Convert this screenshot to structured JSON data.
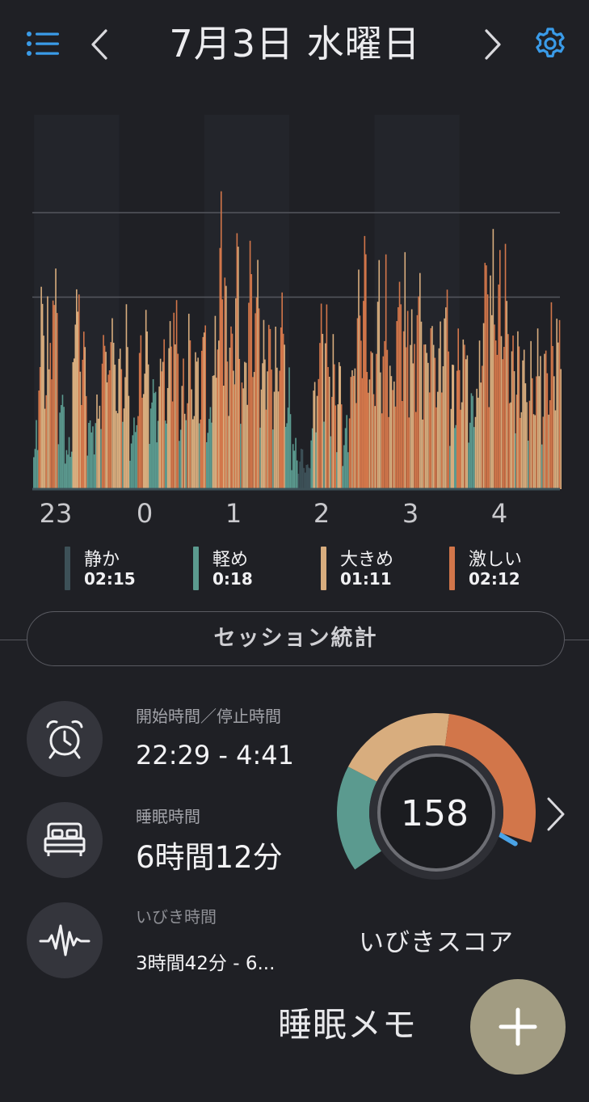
{
  "header": {
    "title": "7月3日 水曜日",
    "menu_icon": "list-icon",
    "prev_icon": "chevron-left-icon",
    "next_icon": "chevron-right-icon",
    "settings_icon": "gear-icon",
    "accent_color": "#3a9be8"
  },
  "chart_data": {
    "type": "bar",
    "x_ticks": [
      "23",
      "0",
      "1",
      "2",
      "3",
      "4"
    ],
    "x_range_hours": [
      22.48,
      4.68
    ],
    "y_range": [
      0,
      1
    ],
    "stacked_by_category": true,
    "grid": true,
    "bin_minutes": 0.9,
    "samples": [
      {
        "t": 22.49,
        "v": 0.24,
        "c": 3
      },
      {
        "t": 22.55,
        "v": 0.7,
        "c": 3
      },
      {
        "t": 22.62,
        "v": 0.58,
        "c": 2
      },
      {
        "t": 22.7,
        "v": 0.86,
        "c": 3
      },
      {
        "t": 22.78,
        "v": 0.42,
        "c": 1
      },
      {
        "t": 22.86,
        "v": 0.18,
        "c": 1
      },
      {
        "t": 22.95,
        "v": 0.75,
        "c": 2
      },
      {
        "t": 23.05,
        "v": 0.52,
        "c": 3
      },
      {
        "t": 23.12,
        "v": 0.3,
        "c": 1
      },
      {
        "t": 23.2,
        "v": 0.34,
        "c": 2
      },
      {
        "t": 23.28,
        "v": 0.62,
        "c": 3
      },
      {
        "t": 23.38,
        "v": 0.74,
        "c": 2
      },
      {
        "t": 23.46,
        "v": 0.5,
        "c": 3
      },
      {
        "t": 23.55,
        "v": 0.62,
        "c": 2
      },
      {
        "t": 23.62,
        "v": 0.28,
        "c": 1
      },
      {
        "t": 23.7,
        "v": 0.47,
        "c": 3
      },
      {
        "t": 23.78,
        "v": 0.58,
        "c": 2
      },
      {
        "t": 23.85,
        "v": 0.35,
        "c": 1
      },
      {
        "t": 23.95,
        "v": 0.52,
        "c": 3
      },
      {
        "t": 24.05,
        "v": 0.6,
        "c": 2
      },
      {
        "t": 24.12,
        "v": 0.72,
        "c": 3
      },
      {
        "t": 24.2,
        "v": 0.4,
        "c": 2
      },
      {
        "t": 24.28,
        "v": 0.55,
        "c": 3
      },
      {
        "t": 24.36,
        "v": 0.46,
        "c": 2
      },
      {
        "t": 24.45,
        "v": 0.66,
        "c": 3
      },
      {
        "t": 24.52,
        "v": 0.3,
        "c": 1
      },
      {
        "t": 24.58,
        "v": 0.55,
        "c": 2
      },
      {
        "t": 24.65,
        "v": 0.98,
        "c": 3
      },
      {
        "t": 24.72,
        "v": 0.8,
        "c": 3
      },
      {
        "t": 24.78,
        "v": 0.6,
        "c": 2
      },
      {
        "t": 24.85,
        "v": 0.92,
        "c": 3
      },
      {
        "t": 24.92,
        "v": 0.5,
        "c": 2
      },
      {
        "t": 25.0,
        "v": 0.78,
        "c": 3
      },
      {
        "t": 25.08,
        "v": 0.82,
        "c": 3
      },
      {
        "t": 25.15,
        "v": 0.64,
        "c": 2
      },
      {
        "t": 25.22,
        "v": 0.78,
        "c": 3
      },
      {
        "t": 25.3,
        "v": 0.5,
        "c": 2
      },
      {
        "t": 25.38,
        "v": 0.76,
        "c": 3
      },
      {
        "t": 25.45,
        "v": 0.4,
        "c": 1
      },
      {
        "t": 25.52,
        "v": 0.2,
        "c": 1
      },
      {
        "t": 25.6,
        "v": 0.12,
        "c": 0
      },
      {
        "t": 25.68,
        "v": 0.1,
        "c": 0
      },
      {
        "t": 25.75,
        "v": 0.4,
        "c": 3
      },
      {
        "t": 25.82,
        "v": 0.65,
        "c": 3
      },
      {
        "t": 25.9,
        "v": 0.64,
        "c": 2
      },
      {
        "t": 25.98,
        "v": 0.55,
        "c": 3
      },
      {
        "t": 26.05,
        "v": 0.38,
        "c": 2
      },
      {
        "t": 26.12,
        "v": 0.22,
        "c": 1
      },
      {
        "t": 26.2,
        "v": 0.48,
        "c": 3
      },
      {
        "t": 26.28,
        "v": 0.72,
        "c": 3
      },
      {
        "t": 26.35,
        "v": 0.8,
        "c": 3
      },
      {
        "t": 26.42,
        "v": 0.56,
        "c": 2
      },
      {
        "t": 26.5,
        "v": 0.78,
        "c": 3
      },
      {
        "t": 26.58,
        "v": 0.74,
        "c": 3
      },
      {
        "t": 26.66,
        "v": 0.5,
        "c": 2
      },
      {
        "t": 26.74,
        "v": 0.75,
        "c": 3
      },
      {
        "t": 26.82,
        "v": 0.7,
        "c": 3
      },
      {
        "t": 26.9,
        "v": 0.62,
        "c": 2
      },
      {
        "t": 26.98,
        "v": 0.74,
        "c": 3
      },
      {
        "t": 27.06,
        "v": 0.66,
        "c": 2
      },
      {
        "t": 27.14,
        "v": 0.7,
        "c": 3
      },
      {
        "t": 27.22,
        "v": 0.58,
        "c": 2
      },
      {
        "t": 27.3,
        "v": 0.72,
        "c": 3
      },
      {
        "t": 27.38,
        "v": 0.4,
        "c": 2
      },
      {
        "t": 27.45,
        "v": 0.55,
        "c": 3
      },
      {
        "t": 27.52,
        "v": 0.62,
        "c": 2
      },
      {
        "t": 27.6,
        "v": 0.3,
        "c": 1
      },
      {
        "t": 27.68,
        "v": 0.45,
        "c": 2
      },
      {
        "t": 27.76,
        "v": 0.86,
        "c": 3
      },
      {
        "t": 27.84,
        "v": 0.84,
        "c": 3
      },
      {
        "t": 27.92,
        "v": 0.88,
        "c": 3
      },
      {
        "t": 28.0,
        "v": 0.84,
        "c": 3
      },
      {
        "t": 28.08,
        "v": 0.6,
        "c": 2
      },
      {
        "t": 28.15,
        "v": 0.48,
        "c": 3
      },
      {
        "t": 28.22,
        "v": 0.52,
        "c": 2
      },
      {
        "t": 28.3,
        "v": 0.44,
        "c": 3
      },
      {
        "t": 28.38,
        "v": 0.56,
        "c": 2
      },
      {
        "t": 28.46,
        "v": 0.46,
        "c": 3
      },
      {
        "t": 28.54,
        "v": 0.58,
        "c": 3
      },
      {
        "t": 28.62,
        "v": 0.7,
        "c": 2
      }
    ],
    "colors": {
      "quiet": "#3d5158",
      "light": "#5b9a8f",
      "loud": "#d8ad7e",
      "epic": "#d2764a"
    }
  },
  "legend": [
    {
      "label": "静か",
      "value": "02:15",
      "color": "#3d5158"
    },
    {
      "label": "軽め",
      "value": "0:18",
      "color": "#5b9a8f"
    },
    {
      "label": "大きめ",
      "value": "01:11",
      "color": "#d8ad7e"
    },
    {
      "label": "激しい",
      "value": "02:12",
      "color": "#d2764a"
    }
  ],
  "session_button": {
    "label": "セッション統計"
  },
  "stats": [
    {
      "icon": "alarm-clock-icon",
      "label": "開始時間／停止時間",
      "value": "22:29 - 4:41"
    },
    {
      "icon": "bed-icon",
      "label": "睡眠時間",
      "value": "6時間12分"
    },
    {
      "icon": "waveform-icon",
      "label": "いびき時間",
      "value": "3時間42分 - 6..."
    }
  ],
  "gauge": {
    "score": "158",
    "label": "いびきスコア",
    "segments": [
      {
        "fraction": 0.25,
        "color": "#5b9a8f"
      },
      {
        "fraction": 0.28,
        "color": "#d8ad7e"
      },
      {
        "fraction": 0.4,
        "color": "#d2764a"
      },
      {
        "fraction": 0.07,
        "color": "#4aa3e6"
      }
    ],
    "next_icon": "chevron-right-icon"
  },
  "memo": {
    "label": "睡眠メモ",
    "add_icon": "plus-icon",
    "fab_color": "#a29c82"
  }
}
